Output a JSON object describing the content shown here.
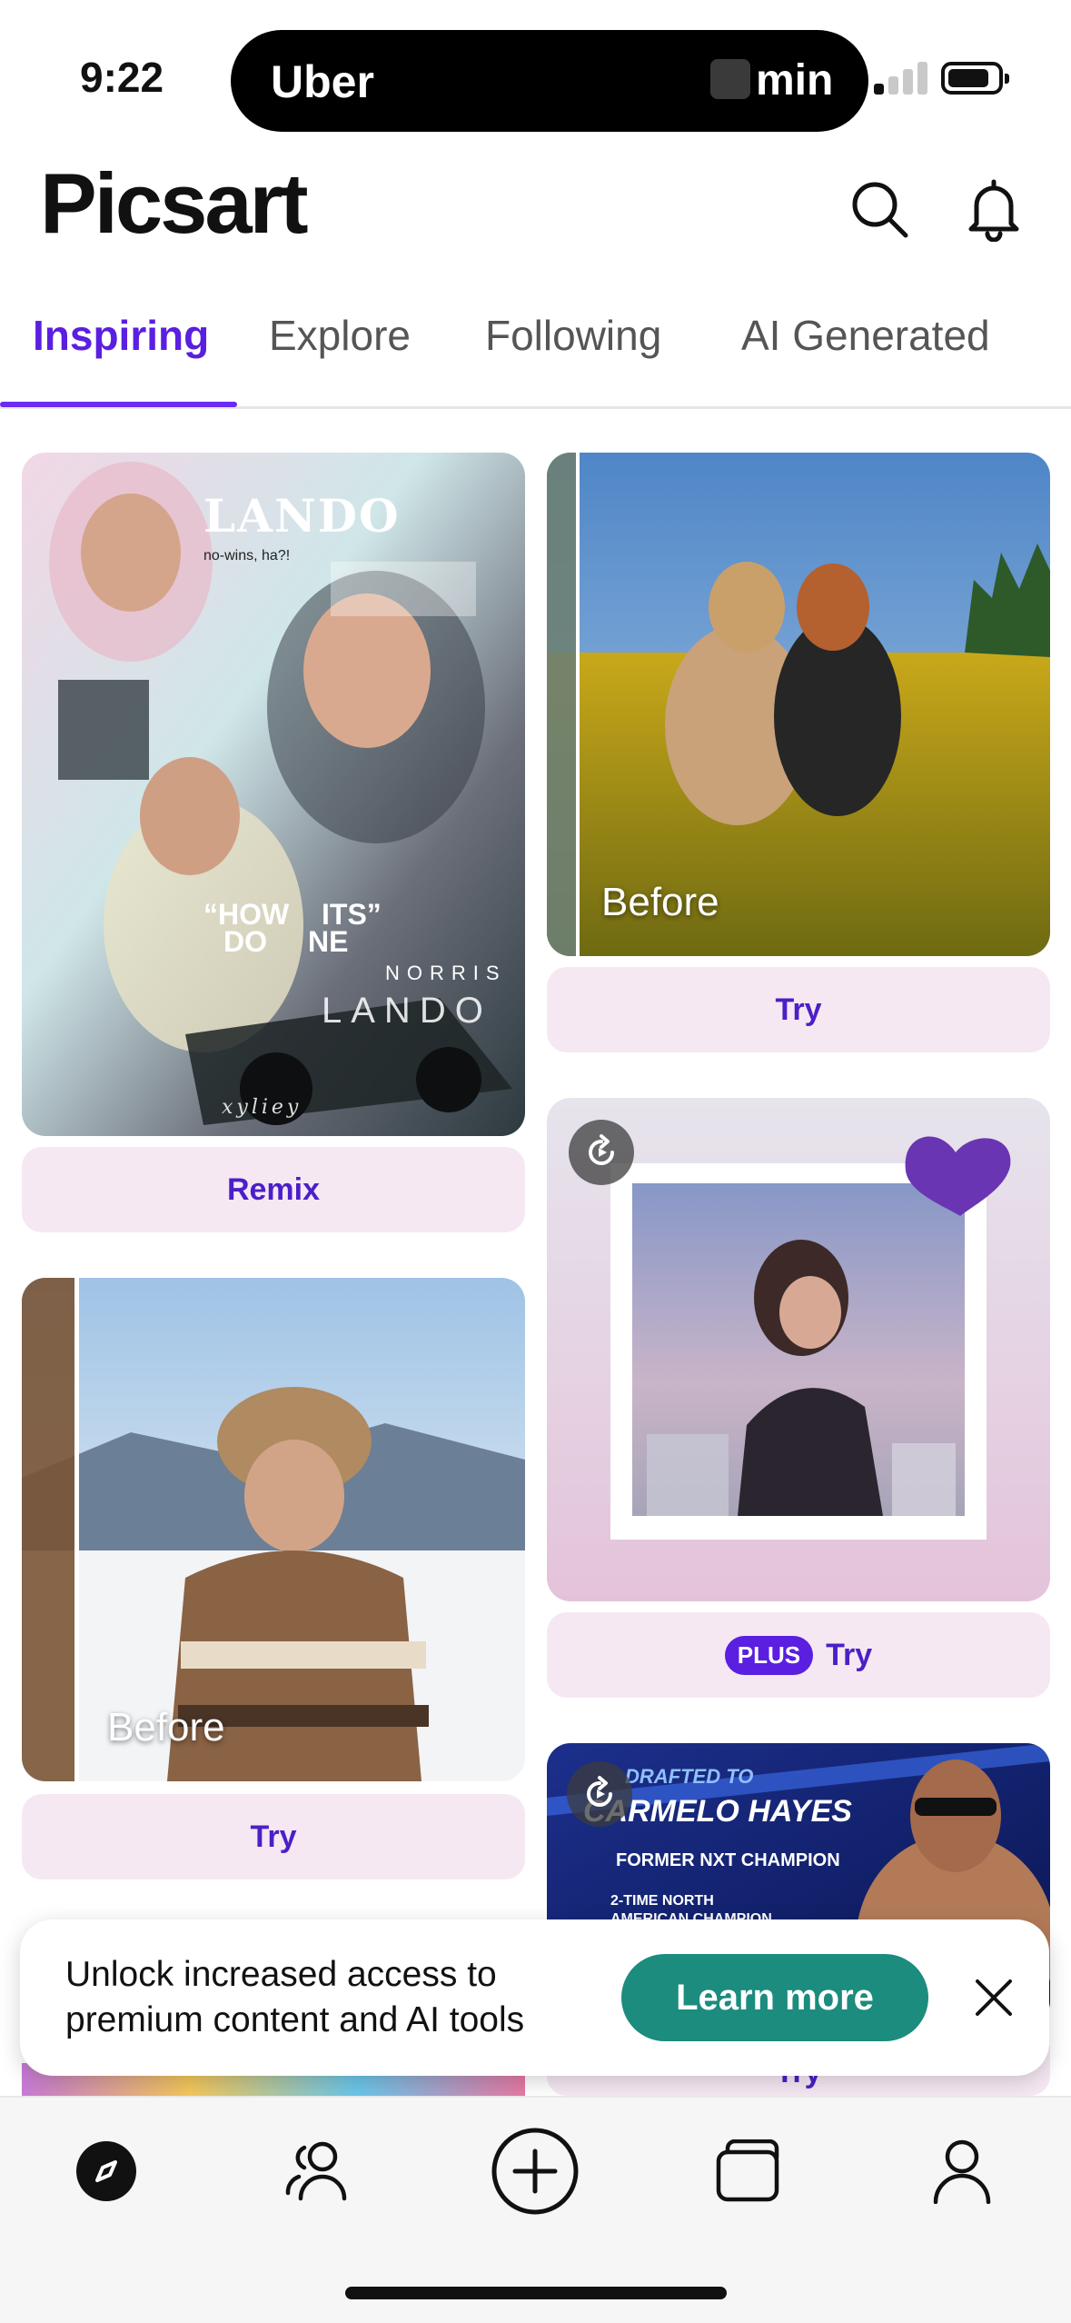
{
  "status_bar": {
    "time": "9:22",
    "live_activity": {
      "app": "Uber",
      "eta_unit": "min"
    },
    "signal_icon": "cellular-signal-icon",
    "battery_icon": "battery-icon"
  },
  "header": {
    "logo": "Picsart",
    "icons": [
      "search-icon",
      "bell-icon"
    ]
  },
  "tabs": [
    {
      "label": "Inspiring",
      "active": true
    },
    {
      "label": "Explore",
      "active": false
    },
    {
      "label": "Following",
      "active": false
    },
    {
      "label": "AI Generated",
      "active": false
    }
  ],
  "feed": {
    "cards": [
      {
        "id": "lando-collage",
        "button": "Remix",
        "image_text": [
          "LANDO",
          "no-wins, ha?!",
          "“HOW",
          "ITS”",
          "DO",
          "NE",
          "NORRIS",
          "LANDO",
          "xyliey"
        ]
      },
      {
        "id": "field-couple",
        "overlay": "Before",
        "button": "Try"
      },
      {
        "id": "winter-sweater",
        "overlay": "Before",
        "button": "Try"
      },
      {
        "id": "paper-frame",
        "badge": "PLUS",
        "button": "Try"
      },
      {
        "id": "wrestler-promo",
        "image_text": [
          "DRAFTED TO",
          "CARMELO HAYES",
          "FORMER NXT CHAMPION",
          "2-TIME NORTH AMERICAN CHAMPION"
        ],
        "button": "Try"
      }
    ]
  },
  "banner": {
    "text": "Unlock increased access to premium content and AI tools",
    "cta": "Learn more",
    "close_icon": "close-icon"
  },
  "bottom_nav": {
    "items": [
      "compass-icon",
      "people-icon",
      "plus-circle-icon",
      "folder-icon",
      "profile-icon"
    ],
    "active": "compass-icon"
  },
  "colors": {
    "accent": "#5a1fe0",
    "button_bg": "#f5e8f3",
    "cta": "#1b8c7e"
  }
}
